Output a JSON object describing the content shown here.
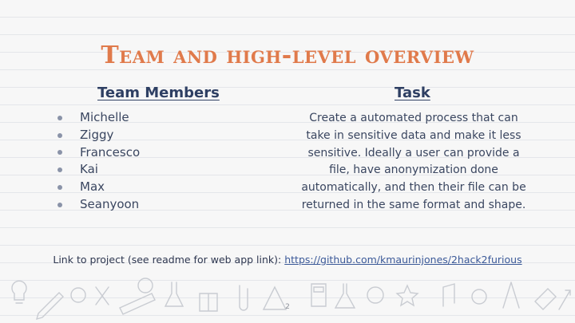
{
  "slide": {
    "title": "Team and high-level overview",
    "members_heading": "Team Members",
    "task_heading": "Task",
    "members": [
      "Michelle",
      "Ziggy",
      "Francesco",
      "Kai",
      "Max",
      "Seanyoon"
    ],
    "task_text": "Create a automated process that can take in sensitive data and make it less sensitive. Ideally a user can provide a file, have anonymization done automatically, and then their file can be returned in the same format and shape.",
    "footer_label": "Link to project (see readme for web app link): ",
    "footer_link": "https://github.com/kmaurinjones/2hack2furious",
    "page_number": "2"
  },
  "colors": {
    "title": "#e07a4b",
    "heading": "#2e3f63",
    "link": "#3b5998"
  }
}
